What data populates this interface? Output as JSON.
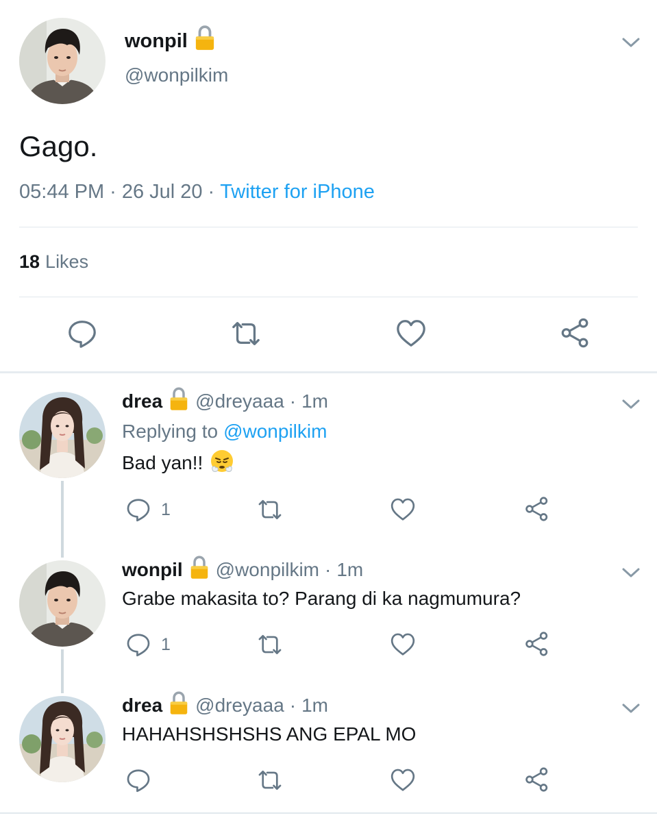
{
  "main_tweet": {
    "name": "wonpil",
    "handle": "@wonpilkim",
    "text": "Gago.",
    "time": "05:44 PM",
    "date": "26 Jul 20",
    "separator": "·",
    "source": "Twitter for iPhone",
    "likes_count": "18",
    "likes_label": "Likes"
  },
  "replies": [
    {
      "name": "drea",
      "handle": "@dreyaaa",
      "dot": "·",
      "time": "1m",
      "replying_label": "Replying to",
      "replying_to": "@wonpilkim",
      "text": "Bad yan!!",
      "reply_count": "1"
    },
    {
      "name": "wonpil",
      "handle": "@wonpilkim",
      "dot": "·",
      "time": "1m",
      "text": "Grabe makasita to? Parang di ka nagmumura?",
      "reply_count": "1"
    },
    {
      "name": "drea",
      "handle": "@dreyaaa",
      "dot": "·",
      "time": "1m",
      "text": "HAHAHSHSHSHS ANG EPAL MO",
      "reply_count": ""
    }
  ],
  "icons": [
    "lock-icon",
    "chevron-down-icon",
    "reply-icon",
    "retweet-icon",
    "like-icon",
    "share-icon",
    "steam-from-nose-emoji"
  ],
  "colors": {
    "link": "#1da1f2",
    "secondary_text": "#657786",
    "lock": "#f5b40f"
  }
}
